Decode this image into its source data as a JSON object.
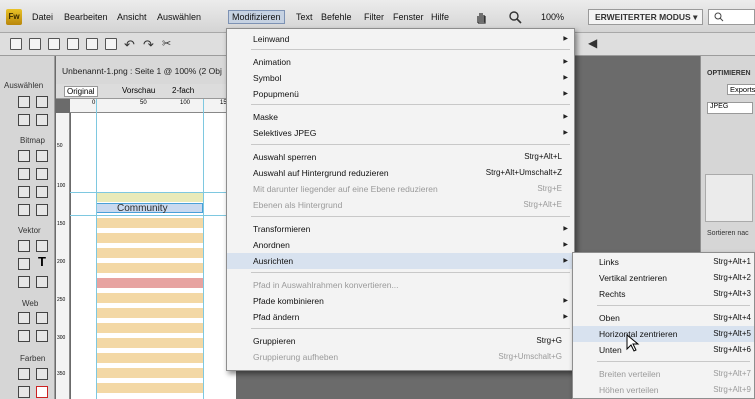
{
  "app": {
    "logo": "Fw"
  },
  "menubar": {
    "items": [
      "Datei",
      "Bearbeiten",
      "Ansicht",
      "Auswählen",
      "Modifizieren",
      "Text",
      "Befehle",
      "Filter",
      "Fenster",
      "Hilfe"
    ],
    "zoom": "100%",
    "mode": "ERWEITERTER MODUS ▾",
    "search_icon": "search-icon"
  },
  "document": {
    "title": "Unbenannt-1.png : Seite 1 @ 100% (2 Obj",
    "tabs": [
      "Original",
      "Vorschau",
      "2-fach"
    ],
    "selected_text": "Community",
    "ruler_top": [
      "0",
      "50",
      "100",
      "150"
    ],
    "ruler_left": [
      "50",
      "100",
      "150",
      "200",
      "250",
      "300",
      "350",
      "400"
    ]
  },
  "tools": {
    "sections": [
      "Auswählen",
      "Bitmap",
      "Vektor",
      "Web",
      "Farben"
    ]
  },
  "right_panel": {
    "tab": "OPTIMIEREN",
    "subtab": "Exports",
    "format": "JPEG",
    "sort": "Sortieren nac"
  },
  "modify_menu": {
    "items": [
      {
        "label": "Leinwand",
        "shortcut": "",
        "submenu": true,
        "disabled": false
      },
      {
        "label": "Animation",
        "shortcut": "",
        "submenu": true,
        "disabled": false
      },
      {
        "label": "Symbol",
        "shortcut": "",
        "submenu": true,
        "disabled": false
      },
      {
        "label": "Popupmenü",
        "shortcut": "",
        "submenu": true,
        "disabled": false
      },
      {
        "label": "Maske",
        "shortcut": "",
        "submenu": true,
        "disabled": false
      },
      {
        "label": "Selektives JPEG",
        "shortcut": "",
        "submenu": true,
        "disabled": false
      },
      {
        "label": "Auswahl sperren",
        "shortcut": "Strg+Alt+L",
        "submenu": false,
        "disabled": false
      },
      {
        "label": "Auswahl auf Hintergrund reduzieren",
        "shortcut": "Strg+Alt+Umschalt+Z",
        "submenu": false,
        "disabled": false
      },
      {
        "label": "Mit darunter liegender auf eine Ebene reduzieren",
        "shortcut": "Strg+E",
        "submenu": false,
        "disabled": true
      },
      {
        "label": "Ebenen als Hintergrund",
        "shortcut": "Strg+Alt+E",
        "submenu": false,
        "disabled": true
      },
      {
        "label": "Transformieren",
        "shortcut": "",
        "submenu": true,
        "disabled": false
      },
      {
        "label": "Anordnen",
        "shortcut": "",
        "submenu": true,
        "disabled": false
      },
      {
        "label": "Ausrichten",
        "shortcut": "",
        "submenu": true,
        "disabled": false
      },
      {
        "label": "Pfad in Auswahlrahmen konvertieren...",
        "shortcut": "",
        "submenu": false,
        "disabled": true
      },
      {
        "label": "Pfade kombinieren",
        "shortcut": "",
        "submenu": true,
        "disabled": false
      },
      {
        "label": "Pfad ändern",
        "shortcut": "",
        "submenu": true,
        "disabled": false
      },
      {
        "label": "Gruppieren",
        "shortcut": "Strg+G",
        "submenu": false,
        "disabled": false
      },
      {
        "label": "Gruppierung aufheben",
        "shortcut": "Strg+Umschalt+G",
        "submenu": false,
        "disabled": true
      }
    ]
  },
  "align_menu": {
    "items": [
      {
        "label": "Links",
        "shortcut": "Strg+Alt+1",
        "disabled": false
      },
      {
        "label": "Vertikal zentrieren",
        "shortcut": "Strg+Alt+2",
        "disabled": false
      },
      {
        "label": "Rechts",
        "shortcut": "Strg+Alt+3",
        "disabled": false
      },
      {
        "label": "Oben",
        "shortcut": "Strg+Alt+4",
        "disabled": false
      },
      {
        "label": "Horizontal zentrieren",
        "shortcut": "Strg+Alt+5",
        "disabled": false
      },
      {
        "label": "Unten",
        "shortcut": "Strg+Alt+6",
        "disabled": false
      },
      {
        "label": "Breiten verteilen",
        "shortcut": "Strg+Alt+7",
        "disabled": true
      },
      {
        "label": "Höhen verteilen",
        "shortcut": "Strg+Alt+9",
        "disabled": true
      }
    ]
  }
}
